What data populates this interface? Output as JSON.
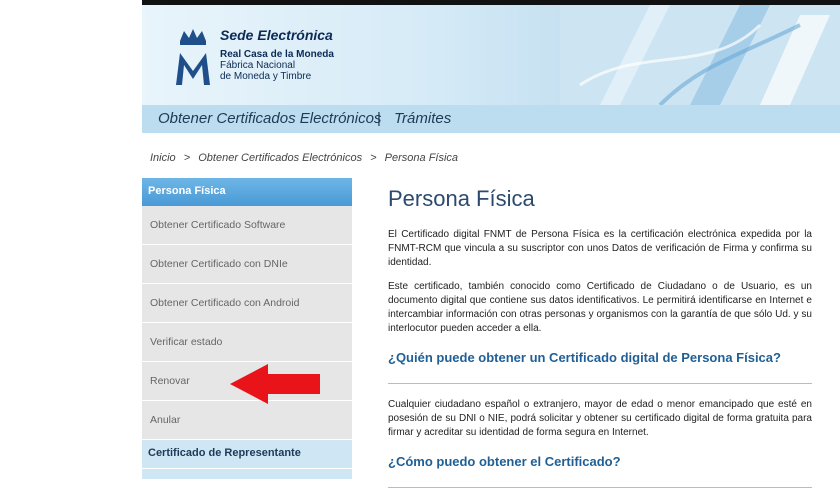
{
  "header": {
    "site_title": "Sede Electrónica",
    "org_line1": "Real Casa de la Moneda",
    "org_line2": "Fábrica Nacional",
    "org_line3": "de Moneda y Timbre"
  },
  "nav": {
    "item1": "Obtener Certificados Electrónicos",
    "separator": "|",
    "item2": "Trámites"
  },
  "breadcrumb": {
    "items": [
      "Inicio",
      ">",
      "Obtener Certificados Electrónicos",
      ">",
      "Persona Física"
    ]
  },
  "sidebar": {
    "section_title": "Persona Física",
    "items": [
      {
        "label": "Obtener Certificado Software"
      },
      {
        "label": "Obtener Certificado con DNIe"
      },
      {
        "label": "Obtener Certificado con Android"
      },
      {
        "label": "Verificar estado"
      },
      {
        "label": "Renovar"
      },
      {
        "label": "Anular"
      }
    ],
    "section2_title": "Certificado de Representante"
  },
  "main": {
    "title": "Persona Física",
    "para1": "El Certificado digital FNMT de Persona Física es la certificación electrónica expedida por la FNMT-RCM que vincula a su suscriptor con unos Datos de verificación de Firma y confirma su identidad.",
    "para2": "Este certificado, también conocido como Certificado de Ciudadano o de Usuario, es un documento digital que contiene sus datos identificativos. Le permitirá identificarse en Internet e intercambiar información con otras personas y organismos con la garantía de que sólo Ud. y su interlocutor pueden acceder a ella.",
    "heading1": "¿Quién puede obtener un Certificado digital de Persona Física?",
    "para3": "Cualquier ciudadano español o extranjero, mayor de edad o menor emancipado que esté en posesión de su DNI o NIE, podrá solicitar y obtener su certificado digital de forma gratuita para firmar y acreditar su identidad de forma segura en Internet.",
    "heading2": "¿Cómo puedo obtener el Certificado?"
  },
  "colors": {
    "nav_bg": "#bcdcef",
    "sidebar_header": "#4a9ad6",
    "heading_link": "#1f5f96",
    "annotation_arrow": "#e8141a"
  },
  "icons": {
    "logo": "crown-m-logo",
    "annotation": "left-arrow-annotation"
  }
}
